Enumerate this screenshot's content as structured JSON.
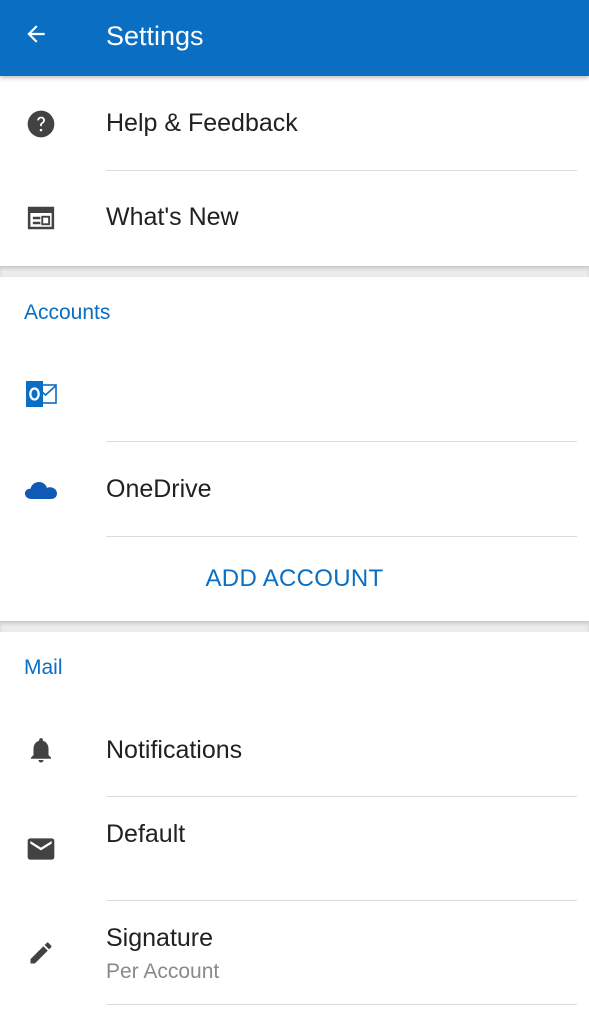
{
  "app_bar": {
    "title": "Settings",
    "back_icon": "arrow-left-icon",
    "color": "#0a6fc2"
  },
  "general": {
    "items": [
      {
        "label": "Help & Feedback",
        "icon": "help-circle-icon"
      },
      {
        "label": "What's New",
        "icon": "calendar-icon"
      }
    ]
  },
  "accounts": {
    "header": "Accounts",
    "items": [
      {
        "label": "",
        "icon": "outlook-icon"
      },
      {
        "label": "OneDrive",
        "icon": "onedrive-cloud-icon"
      }
    ],
    "add_account_label": "ADD ACCOUNT"
  },
  "mail": {
    "header": "Mail",
    "items": [
      {
        "label": "Notifications",
        "icon": "bell-icon"
      },
      {
        "label": "Default",
        "sublabel": "",
        "icon": "envelope-icon"
      },
      {
        "label": "Signature",
        "sublabel": "Per Account",
        "icon": "pencil-icon"
      }
    ]
  },
  "colors": {
    "accent": "#0a6fc2",
    "icon_gray": "#424242",
    "onedrive_blue": "#0f5ab5"
  }
}
